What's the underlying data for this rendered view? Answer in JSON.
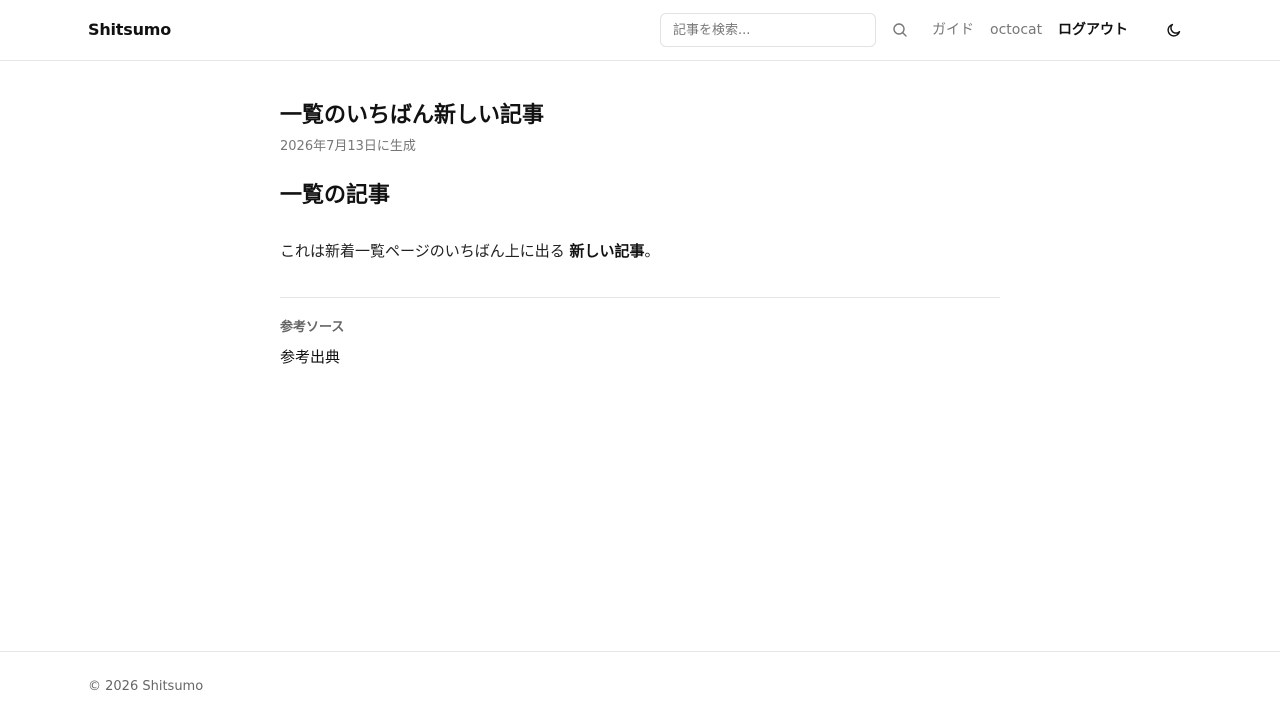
{
  "header": {
    "brand": "Shitsumo",
    "search": {
      "placeholder": "記事を検索...",
      "value": "",
      "button_icon": "search-icon"
    },
    "nav": {
      "guide": "ガイド",
      "user": "octocat",
      "logout": "ログアウト"
    },
    "theme_toggle_icon": "moon-icon"
  },
  "article": {
    "title": "一覧のいちばん新しい記事",
    "date": "2026年7月13日に生成",
    "section_heading": "一覧の記事",
    "body": {
      "text_before": "これは新着一覧ページのいちばん上に出る ",
      "bold": "新しい記事",
      "text_after": "。"
    },
    "sources": {
      "label": "参考ソース",
      "link": "参考出典"
    }
  },
  "footer": {
    "copyright": "© 2026 Shitsumo"
  },
  "colors": {
    "text": "#111111",
    "muted": "#777777",
    "border": "#e5e5e5",
    "background": "#ffffff"
  }
}
